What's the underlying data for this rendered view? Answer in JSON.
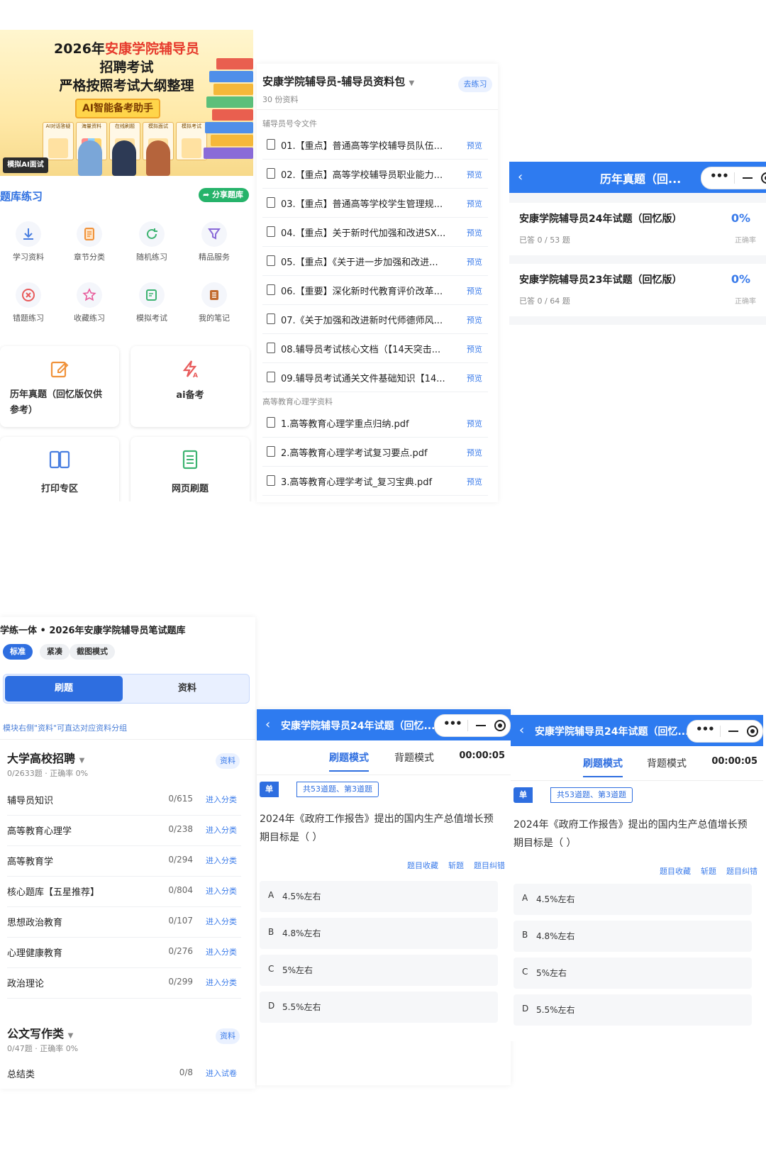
{
  "home": {
    "banner": {
      "line1_prefix": "2026年",
      "line1_highlight": "安康学院辅导员",
      "line2": "招聘考试",
      "line3": "严格按照考试大纲整理",
      "ai_badge": "AI智能备考助手",
      "cards": [
        "AI对话答疑",
        "海量资料",
        "在线刷题",
        "模拟面试",
        "模拟考试"
      ],
      "mock_interview": "模拟AI面试"
    },
    "section_title": "题库练习",
    "share_button": "分享题库",
    "grid": [
      {
        "label": "学习资料",
        "icon": "download-icon"
      },
      {
        "label": "章节分类",
        "icon": "document-icon"
      },
      {
        "label": "随机练习",
        "icon": "refresh-icon"
      },
      {
        "label": "精品服务",
        "icon": "filter-icon"
      },
      {
        "label": "错题练习",
        "icon": "close-circle-icon"
      },
      {
        "label": "收藏练习",
        "icon": "star-icon"
      },
      {
        "label": "模拟考试",
        "icon": "edit-doc-icon"
      },
      {
        "label": "我的笔记",
        "icon": "notebook-icon"
      }
    ],
    "cards": [
      {
        "label": "历年真题（回忆版仅供参考）",
        "icon": "edit-icon"
      },
      {
        "label": "ai备考",
        "icon": "ai-icon"
      },
      {
        "label": "打印专区",
        "icon": "book-icon"
      },
      {
        "label": "网页刷题",
        "icon": "list-icon"
      }
    ]
  },
  "resources": {
    "title": "安康学院辅导员-辅导员资料包",
    "count": "30 份资料",
    "go_button": "去练习",
    "sections": [
      {
        "title": "辅导员号令文件",
        "files": [
          "01.【重点】普通高等学校辅导员队伍...",
          "02.【重点】高等学校辅导员职业能力...",
          "03.【重点】普通高等学校学生管理规...",
          "04.【重点】关于新时代加强和改进SX...",
          "05.【重点】《关于进一步加强和改进...",
          "06.【重要】深化新时代教育评价改革...",
          "07.《关于加强和改进新时代师德师风...",
          "08.辅导员考试核心文档（【14天突击...",
          "09.辅导员考试通关文件基础知识【14..."
        ]
      },
      {
        "title": "高等教育心理学资料",
        "files": [
          "1.高等教育心理学重点归纳.pdf",
          "2.高等教育心理学考试复习要点.pdf",
          "3.高等教育心理学考试_复习宝典.pdf"
        ]
      }
    ],
    "preview_label": "预览"
  },
  "past_exams": {
    "title": "历年真题（回...",
    "items": [
      {
        "name": "安康学院辅导员24年试题（回忆版）",
        "answered": "已答 0 / 53 题",
        "accuracy": "0%",
        "accuracy_label": "正确率"
      },
      {
        "name": "安康学院辅导员23年试题（回忆版）",
        "answered": "已答 0 / 64 题",
        "accuracy": "0%",
        "accuracy_label": "正确率"
      }
    ]
  },
  "bank": {
    "title": "学练一体 • 2026年安康学院辅导员笔试题库",
    "chips": [
      "标准",
      "紧凑",
      "截图模式"
    ],
    "segment": [
      "刷题",
      "资料"
    ],
    "hint": "模块右侧\"资料\"可直达对应资料分组",
    "groups": [
      {
        "title": "大学高校招聘",
        "sub": "0/2633题 · 正确率 0%",
        "button": "资料",
        "rows": [
          {
            "name": "辅导员知识",
            "count": "0/615",
            "action": "进入分类"
          },
          {
            "name": "高等教育心理学",
            "count": "0/238",
            "action": "进入分类"
          },
          {
            "name": "高等教育学",
            "count": "0/294",
            "action": "进入分类"
          },
          {
            "name": "核心题库【五星推荐】",
            "count": "0/804",
            "action": "进入分类"
          },
          {
            "name": "思想政治教育",
            "count": "0/107",
            "action": "进入分类"
          },
          {
            "name": "心理健康教育",
            "count": "0/276",
            "action": "进入分类"
          },
          {
            "name": "政治理论",
            "count": "0/299",
            "action": "进入分类"
          }
        ]
      },
      {
        "title": "公文写作类",
        "sub": "0/47题 · 正确率 0%",
        "button": "资料",
        "rows": [
          {
            "name": "总结类",
            "count": "0/8",
            "action": "进入试卷"
          }
        ]
      }
    ]
  },
  "quiz": {
    "title": "安康学院辅导员24年试题（回忆...",
    "tabs": [
      "刷题模式",
      "背题模式"
    ],
    "timer": "00:00:05",
    "type_badge": "单选题",
    "progress_badge": "共53道题、第3道题",
    "stem": "2024年《政府工作报告》提出的国内生产总值增长预期目标是（ ）",
    "actions": [
      "题目收藏",
      "斩题",
      "题目纠错"
    ],
    "options": [
      {
        "key": "A",
        "text": "4.5%左右"
      },
      {
        "key": "B",
        "text": "4.8%左右"
      },
      {
        "key": "C",
        "text": "5%左右"
      },
      {
        "key": "D",
        "text": "5.5%左右"
      }
    ]
  },
  "colors": {
    "primary": "#2e6ee0",
    "titlebar": "#2e7bf0",
    "share": "#26b36a",
    "highlight": "#e63a2c"
  }
}
